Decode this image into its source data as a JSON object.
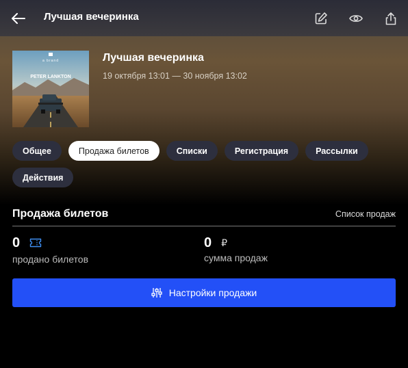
{
  "topbar": {
    "title": "Лучшая вечеринка",
    "icons": [
      "back-arrow-icon",
      "edit-icon",
      "eye-icon",
      "share-icon"
    ]
  },
  "cover": {
    "small_text": "a brand",
    "artist": "PETER LANKTON"
  },
  "event": {
    "title": "Лучшая вечеринка",
    "dates": "19 октября 13:01 — 30 ноября 13:02"
  },
  "tabs": [
    {
      "label": "Общее",
      "active": false
    },
    {
      "label": "Продажа билетов",
      "active": true
    },
    {
      "label": "Списки",
      "active": false
    },
    {
      "label": "Регистрация",
      "active": false
    },
    {
      "label": "Рассылки",
      "active": false
    },
    {
      "label": "Действия",
      "active": false
    }
  ],
  "sales": {
    "title": "Продажа билетов",
    "link": "Список продаж",
    "tickets_value": "0",
    "tickets_label": "продано билетов",
    "sum_value": "0",
    "currency": "₽",
    "sum_label": "сумма продаж",
    "settings_button": "Настройки продажи"
  },
  "colors": {
    "accent": "#2350f7",
    "ticket_icon": "#3e8ef2",
    "chip_bg": "#2d2f3e"
  }
}
